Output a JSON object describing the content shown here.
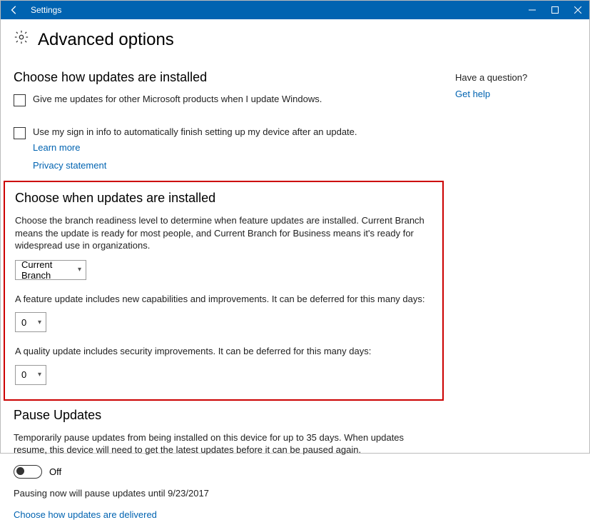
{
  "window": {
    "title": "Settings"
  },
  "page": {
    "heading": "Advanced options"
  },
  "sections": {
    "install_how": {
      "title": "Choose how updates are installed",
      "check_other_products": "Give me updates for other Microsoft products when I update Windows.",
      "check_signin": "Use my sign in info to automatically finish setting up my device after an update.",
      "learn_more": "Learn more",
      "privacy": "Privacy statement"
    },
    "install_when": {
      "title": "Choose when updates are installed",
      "desc": "Choose the branch readiness level to determine when feature updates are installed. Current Branch means the update is ready for most people, and Current Branch for Business means it's ready for widespread use in organizations.",
      "branch_value": "Current Branch",
      "feature_text": "A feature update includes new capabilities and improvements. It can be deferred for this many days:",
      "feature_defer_value": "0",
      "quality_text": "A quality update includes security improvements. It can be deferred for this many days:",
      "quality_defer_value": "0"
    },
    "pause": {
      "title": "Pause Updates",
      "desc": "Temporarily pause updates from being installed on this device for up to 35 days. When updates resume, this device will need to get the latest updates before it can be paused again.",
      "toggle_label": "Off",
      "note": "Pausing now will pause updates until 9/23/2017"
    },
    "delivery_link": "Choose how updates are delivered"
  },
  "sidebar": {
    "question": "Have a question?",
    "help_link": "Get help"
  }
}
